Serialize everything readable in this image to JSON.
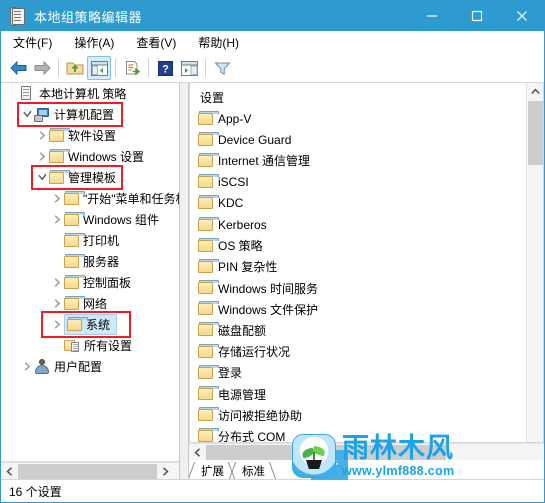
{
  "window": {
    "title": "本地组策略编辑器",
    "title_icon": "scroll-policy-icon",
    "accent_color": "#2e9bd0",
    "controls": {
      "minimize": "—",
      "maximize": "□",
      "close": "✕"
    }
  },
  "menubar": {
    "items": [
      {
        "label": "文件(F)",
        "name": "menu-file"
      },
      {
        "label": "操作(A)",
        "name": "menu-action"
      },
      {
        "label": "查看(V)",
        "name": "menu-view"
      },
      {
        "label": "帮助(H)",
        "name": "menu-help"
      }
    ]
  },
  "toolbar": {
    "buttons": [
      {
        "name": "back-icon",
        "label": "后退"
      },
      {
        "name": "forward-icon",
        "label": "前进"
      },
      {
        "name": "up-folder-icon",
        "label": "向上"
      },
      {
        "name": "show-hide-tree-icon",
        "label": "显示/隐藏控制台树",
        "selected": true
      },
      {
        "name": "export-list-icon",
        "label": "导出列表"
      },
      {
        "name": "help-icon",
        "label": "帮助"
      },
      {
        "name": "show-pane-icon",
        "label": "显示操作窗格"
      },
      {
        "name": "filter-icon",
        "label": "筛选器"
      }
    ]
  },
  "tree": {
    "nodes": [
      {
        "label": "本地计算机 策略",
        "icon": "scroll-policy-icon",
        "indent": 0,
        "chevron": "none",
        "highlight": false,
        "selected": false
      },
      {
        "label": "计算机配置",
        "icon": "computer-icon",
        "indent": 1,
        "chevron": "expanded",
        "highlight": true,
        "selected": false
      },
      {
        "label": "软件设置",
        "icon": "folder-icon",
        "indent": 2,
        "chevron": "collapsed",
        "highlight": false,
        "selected": false
      },
      {
        "label": "Windows 设置",
        "icon": "folder-icon",
        "indent": 2,
        "chevron": "collapsed",
        "highlight": false,
        "selected": false
      },
      {
        "label": "管理模板",
        "icon": "folder-icon",
        "indent": 2,
        "chevron": "expanded",
        "highlight": true,
        "selected": false
      },
      {
        "label": "\"开始\"菜单和任务栏",
        "icon": "folder-icon",
        "indent": 3,
        "chevron": "collapsed",
        "highlight": false,
        "selected": false
      },
      {
        "label": "Windows 组件",
        "icon": "folder-icon",
        "indent": 3,
        "chevron": "collapsed",
        "highlight": false,
        "selected": false
      },
      {
        "label": "打印机",
        "icon": "folder-icon",
        "indent": 3,
        "chevron": "none",
        "highlight": false,
        "selected": false
      },
      {
        "label": "服务器",
        "icon": "folder-icon",
        "indent": 3,
        "chevron": "none",
        "highlight": false,
        "selected": false
      },
      {
        "label": "控制面板",
        "icon": "folder-icon",
        "indent": 3,
        "chevron": "collapsed",
        "highlight": false,
        "selected": false
      },
      {
        "label": "网络",
        "icon": "folder-icon",
        "indent": 3,
        "chevron": "collapsed",
        "highlight": false,
        "selected": false
      },
      {
        "label": "系统",
        "icon": "folder-icon",
        "indent": 3,
        "chevron": "collapsed",
        "highlight": true,
        "selected": true
      },
      {
        "label": "所有设置",
        "icon": "all-settings-icon",
        "indent": 3,
        "chevron": "none",
        "highlight": false,
        "selected": false
      },
      {
        "label": "用户配置",
        "icon": "user-icon",
        "indent": 1,
        "chevron": "collapsed",
        "highlight": false,
        "selected": false
      }
    ]
  },
  "list": {
    "header": "设置",
    "items": [
      {
        "label": "App-V",
        "icon": "folder-icon"
      },
      {
        "label": "Device Guard",
        "icon": "folder-icon"
      },
      {
        "label": "Internet 通信管理",
        "icon": "folder-icon"
      },
      {
        "label": "iSCSI",
        "icon": "folder-icon"
      },
      {
        "label": "KDC",
        "icon": "folder-icon"
      },
      {
        "label": "Kerberos",
        "icon": "folder-icon"
      },
      {
        "label": "OS 策略",
        "icon": "folder-icon"
      },
      {
        "label": "PIN 复杂性",
        "icon": "folder-icon"
      },
      {
        "label": "Windows 时间服务",
        "icon": "folder-icon"
      },
      {
        "label": "Windows 文件保护",
        "icon": "folder-icon"
      },
      {
        "label": "磁盘配额",
        "icon": "folder-icon"
      },
      {
        "label": "存储运行状况",
        "icon": "folder-icon"
      },
      {
        "label": "登录",
        "icon": "folder-icon"
      },
      {
        "label": "电源管理",
        "icon": "folder-icon"
      },
      {
        "label": "访问被拒绝协助",
        "icon": "folder-icon"
      },
      {
        "label": "分布式 COM",
        "icon": "folder-icon"
      }
    ]
  },
  "tabs": [
    {
      "label": "扩展",
      "name": "tab-extended",
      "active": false
    },
    {
      "label": "标准",
      "name": "tab-standard",
      "active": true
    }
  ],
  "statusbar": {
    "text": "16 个设置"
  },
  "watermark": {
    "brand": "雨林木风",
    "url": "www.ylmf888.com",
    "color": "#1aa3e8"
  }
}
